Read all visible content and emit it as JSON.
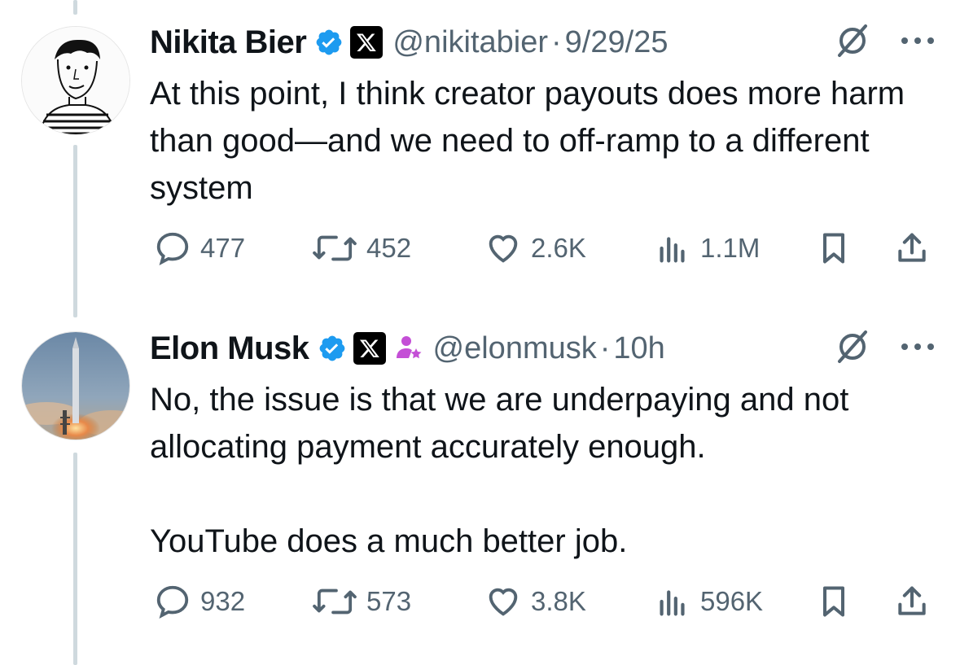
{
  "tweets": [
    {
      "name": "Nikita Bier",
      "handle": "@nikitabier",
      "separator": "·",
      "time": "9/29/25",
      "text": "At this point, I think creator payouts does more harm than good—and we need to off-ramp to a different system",
      "replies": "477",
      "retweets": "452",
      "likes": "2.6K",
      "views": "1.1M"
    },
    {
      "name": "Elon Musk",
      "handle": "@elonmusk",
      "separator": "·",
      "time": "10h",
      "text": "No, the issue is that we are underpaying and not allocating payment accurately enough.\n\nYouTube does a much better job.",
      "replies": "932",
      "retweets": "573",
      "likes": "3.8K",
      "views": "596K"
    }
  ],
  "colors": {
    "verified": "#1d9bf0",
    "secondary": "#536471",
    "thread_line": "#cfd9de",
    "affiliate": "#c44fd6"
  },
  "icons": [
    "verified-badge-icon",
    "x-logo-icon",
    "affiliate-icon",
    "grok-icon",
    "more-icon",
    "reply-icon",
    "retweet-icon",
    "like-icon",
    "views-icon",
    "bookmark-icon",
    "share-icon"
  ]
}
